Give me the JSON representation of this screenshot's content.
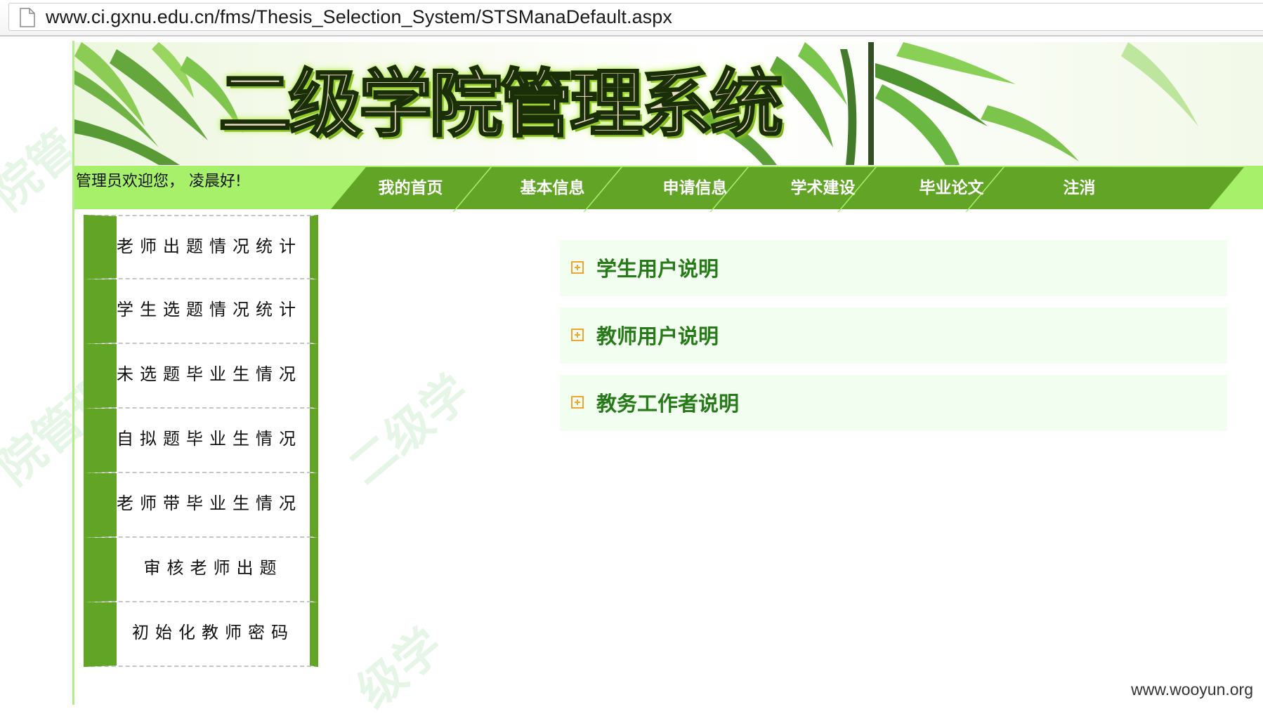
{
  "browser": {
    "url": "www.ci.gxnu.edu.cn/fms/Thesis_Selection_System/STSManaDefault.aspx"
  },
  "banner": {
    "title": "二级学院管理系统"
  },
  "header": {
    "welcome": "管理员欢迎您，  凌晨好!"
  },
  "nav": {
    "items": [
      {
        "label": "我的首页"
      },
      {
        "label": "基本信息"
      },
      {
        "label": "申请信息"
      },
      {
        "label": "学术建设"
      },
      {
        "label": "毕业论文"
      },
      {
        "label": "注消"
      }
    ]
  },
  "sidebar": {
    "items": [
      {
        "label": "老师出题情况统计"
      },
      {
        "label": "学生选题情况统计"
      },
      {
        "label": "未选题毕业生情况"
      },
      {
        "label": "自拟题毕业生情况"
      },
      {
        "label": "老师带毕业生情况"
      },
      {
        "label": "审核老师出题"
      },
      {
        "label": "初始化教师密码"
      }
    ]
  },
  "panels": [
    {
      "title": "学生用户说明",
      "icon": "expand-plus-icon"
    },
    {
      "title": "教师用户说明",
      "icon": "expand-plus-icon"
    },
    {
      "title": "教务工作者说明",
      "icon": "expand-plus-icon"
    }
  ],
  "footer": {
    "watermark": "www.wooyun.org"
  },
  "colors": {
    "nav_dark_green": "#62a526",
    "nav_light_green": "#a6f06a",
    "panel_bg": "#f2fef0",
    "panel_title": "#267a17",
    "expand_icon": "#f3a42c"
  }
}
